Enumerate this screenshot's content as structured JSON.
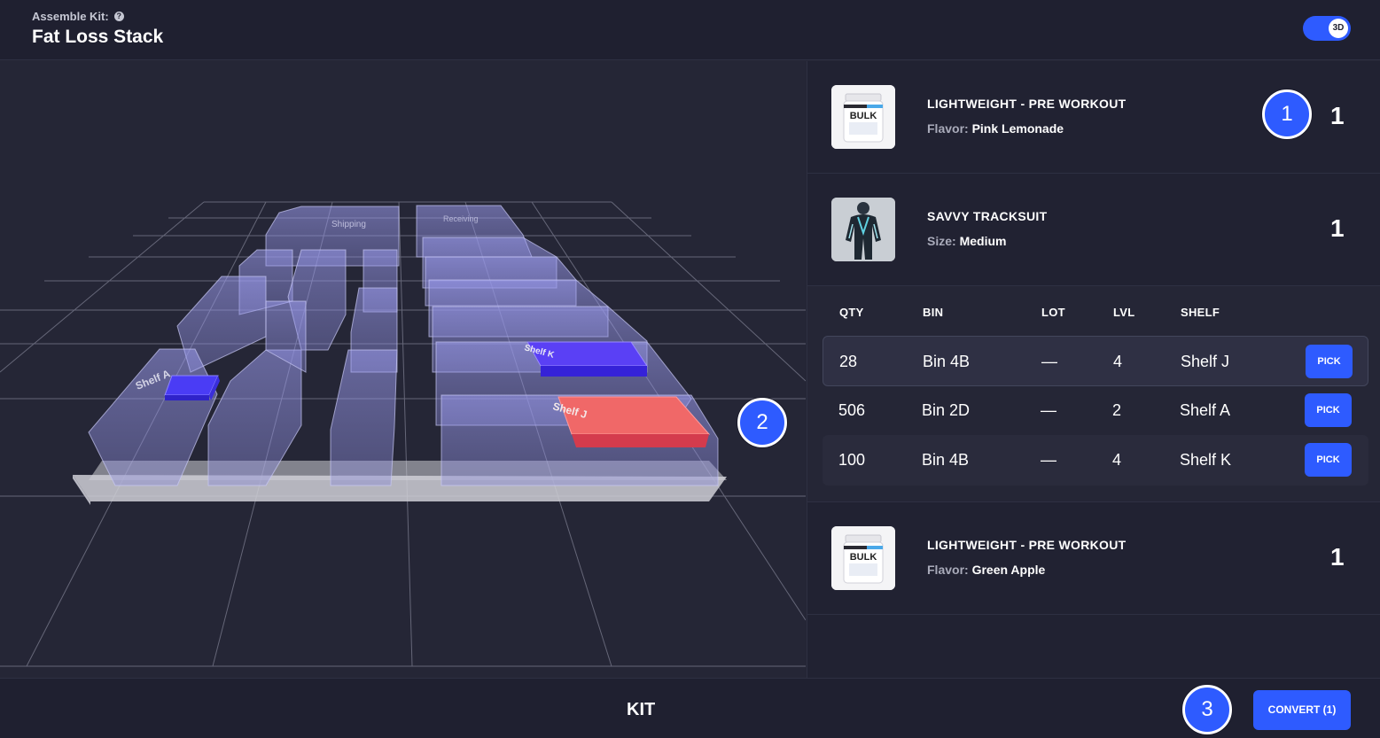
{
  "header": {
    "assemble_label": "Assemble Kit:",
    "help_icon": "?",
    "kit_name": "Fat Loss Stack",
    "toggle_label": "3D"
  },
  "scene": {
    "labels": [
      "Shipping",
      "Receiving",
      "Shelf A",
      "Shelf K",
      "Shelf J"
    ],
    "colors": {
      "shelf": "#8f8fe0",
      "highlight_blue": "#4a3cf5",
      "highlight_red": "#f05c5c",
      "floor": "#cfcfd6"
    }
  },
  "items": [
    {
      "name": "LIGHTWEIGHT - PRE WORKOUT",
      "attr_key": "Flavor:",
      "attr_val": "Pink Lemonade",
      "qty": "1",
      "image": "bulk-tub",
      "image_text": "BULK"
    },
    {
      "name": "SAVVY TRACKSUIT",
      "attr_key": "Size:",
      "attr_val": "Medium",
      "qty": "1",
      "image": "tracksuit"
    },
    {
      "name": "LIGHTWEIGHT - PRE WORKOUT",
      "attr_key": "Flavor:",
      "attr_val": "Green Apple",
      "qty": "1",
      "image": "bulk-tub",
      "image_text": "BULK"
    }
  ],
  "bins": {
    "headers": [
      "QTY",
      "BIN",
      "LOT",
      "LVL",
      "SHELF"
    ],
    "rows": [
      {
        "qty": "28",
        "bin": "Bin 4B",
        "lot": "—",
        "lvl": "4",
        "shelf": "Shelf J",
        "action": "PICK"
      },
      {
        "qty": "506",
        "bin": "Bin 2D",
        "lot": "—",
        "lvl": "2",
        "shelf": "Shelf A",
        "action": "PICK"
      },
      {
        "qty": "100",
        "bin": "Bin 4B",
        "lot": "—",
        "lvl": "4",
        "shelf": "Shelf K",
        "action": "PICK"
      }
    ]
  },
  "footer": {
    "title": "KIT",
    "convert_label": "CONVERT (1)"
  },
  "callouts": [
    "1",
    "2",
    "3"
  ],
  "colors": {
    "accent": "#2e5bff",
    "background": "#252636",
    "panel": "#212232"
  }
}
